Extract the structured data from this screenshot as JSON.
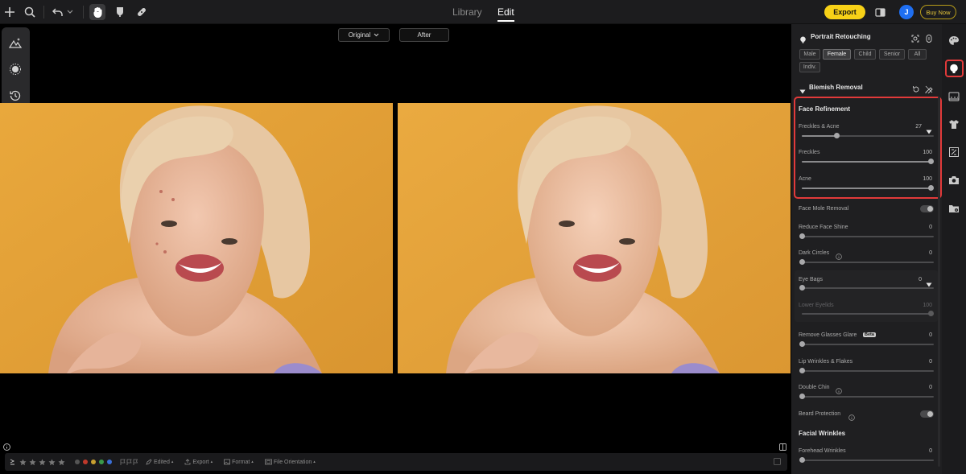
{
  "topbar": {
    "tab_library": "Library",
    "tab_edit": "Edit",
    "export_label": "Export",
    "avatar_initial": "J",
    "buy_label": "Buy Now"
  },
  "view": {
    "original_label": "Original",
    "after_label": "After"
  },
  "bottombar": {
    "edited_label": "Edited",
    "export_label": "Export",
    "format_label": "Format",
    "orientation_label": "File Orientation",
    "label_colors": [
      "#555555",
      "#c0392b",
      "#c8a030",
      "#3a9a4a",
      "#3a6fd8"
    ]
  },
  "panel": {
    "title": "Portrait Retouching",
    "groups": [
      "Male",
      "Female",
      "Child",
      "Senior",
      "All",
      "Indiv."
    ],
    "selected_group": "Female",
    "blemish_title": "Blemish Removal",
    "face_refinement_title": "Face Refinement",
    "freckles_acne": {
      "label": "Freckles & Acne",
      "value": "27"
    },
    "freckles": {
      "label": "Freckles",
      "value": "100"
    },
    "acne": {
      "label": "Acne",
      "value": "100"
    },
    "mole_removal": "Face Mole Removal",
    "shine": {
      "label": "Reduce Face Shine",
      "value": "0"
    },
    "dark_circles": {
      "label": "Dark Circles",
      "value": "0"
    },
    "eye_bags": {
      "label": "Eye Bags",
      "value": "0"
    },
    "lower_eyelids": {
      "label": "Lower Eyelids",
      "value": "100"
    },
    "glasses_glare": {
      "label": "Remove Glasses Glare",
      "badge": "Beta",
      "value": "0"
    },
    "lip_wrinkles": {
      "label": "Lip Wrinkles & Flakes",
      "value": "0"
    },
    "double_chin": {
      "label": "Double Chin",
      "value": "0"
    },
    "beard_protection": "Beard Protection",
    "facial_wrinkles_title": "Facial Wrinkles",
    "forehead": {
      "label": "Forehead Wrinkles",
      "value": "0"
    }
  }
}
